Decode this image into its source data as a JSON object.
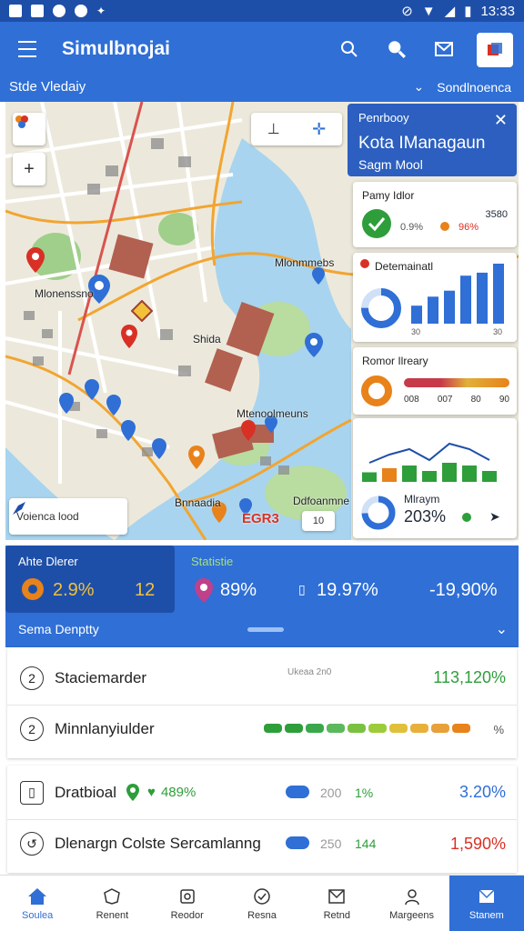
{
  "statusbar": {
    "time": "13:33"
  },
  "appbar": {
    "title": "Simulbnojai",
    "subtitle": "Stde Vledaiy",
    "filter_label": "Sondlnoenca"
  },
  "map": {
    "labels": {
      "l1": "Mlonenssno",
      "l2": "Mlonmmebs",
      "l3": "Shida",
      "l4": "Mtenoolmeuns",
      "l5": "Bnnaadia",
      "l6": "Ddfoanmne",
      "l7": "EGR3",
      "l8": "Voienca lood"
    },
    "zoom_in": "+",
    "scale": "10"
  },
  "overlay_panel": {
    "small": "Penrbooy",
    "title": "Kota IManagaun",
    "sub": "Sagm Mool"
  },
  "widget_priority": {
    "title": "Pamy Idlor",
    "value_top": "3580",
    "value_a": "0.9%",
    "value_b": "96%"
  },
  "widget_deteminatal": {
    "title": "Detemainatl",
    "bars": [
      0.3,
      0.45,
      0.55,
      0.8,
      0.85,
      1.0
    ],
    "bar_labels": [
      "30",
      "",
      "",
      "",
      "",
      "30"
    ]
  },
  "widget_border": {
    "title": "Romor Ilreary",
    "labels": [
      "008",
      "007",
      "80",
      "90"
    ]
  },
  "widget_trend": {
    "title": "Mlraym",
    "value": "203%",
    "bars": [
      0.35,
      0.5,
      0.6,
      0.4,
      0.7,
      0.6,
      0.4
    ]
  },
  "stats": {
    "s1_label": "Ahte Dlerer",
    "s1_val_a": "2.9%",
    "s1_val_b": "12",
    "s2_label": "Statistie",
    "s2_val": "89%",
    "s3_val": "19.97%",
    "s4_val": "-19,90%",
    "section_label": "Sema Denptty"
  },
  "list1": [
    {
      "icon": "2",
      "label": "Staciemarder",
      "mid": "Ukeaa 2n0",
      "value": "113,120%"
    },
    {
      "icon": "2",
      "label": "Minnlanyiulder",
      "value": "%"
    }
  ],
  "list2": [
    {
      "label": "Dratbioal",
      "val_a": "489%",
      "val_b": "200",
      "val_c": "1%",
      "value": "3.20%"
    },
    {
      "label": "Dlenargn Colste Sercamlanng",
      "val_b": "250",
      "val_c": "144",
      "value": "1,590%"
    }
  ],
  "bottom_nav": [
    "Soulea",
    "Renent",
    "Reodor",
    "Resna",
    "Retnd",
    "Margeens",
    "Stanem"
  ],
  "colors": {
    "primary": "#2f6fd6",
    "dark": "#1e4fa8",
    "green": "#2e9e3a",
    "red": "#d93025",
    "orange": "#e8821a"
  }
}
